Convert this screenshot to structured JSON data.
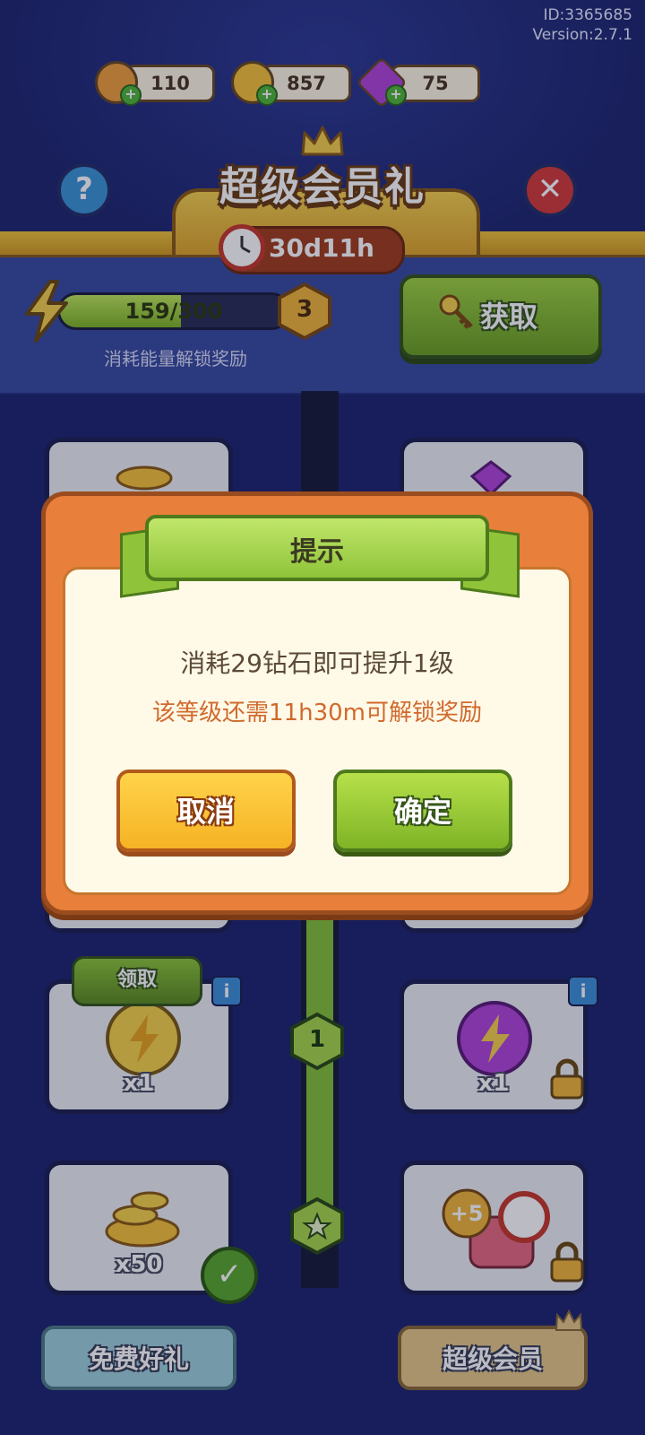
{
  "meta": {
    "id": "ID:3365685",
    "version": "Version:2.7.1"
  },
  "currencies": [
    {
      "name": "ticket",
      "value": "110",
      "icon": "ticket-icon",
      "color": "#f1a03c"
    },
    {
      "name": "coin",
      "value": "857",
      "icon": "coin-icon",
      "color": "#f7c23a"
    },
    {
      "name": "gem",
      "value": "75",
      "icon": "gem-icon",
      "color": "#b246d8"
    }
  ],
  "header": {
    "title": "超级会员礼",
    "timer": "30d11h"
  },
  "energy": {
    "progress_text": "159/300",
    "current": 159,
    "max": 300,
    "level": "3",
    "label": "消耗能量解锁奖励"
  },
  "get_button": {
    "label": "获取"
  },
  "rewards": {
    "claim_label": "领取",
    "free_energy_qty": "x1",
    "vip_energy_qty": "x1",
    "free_coin_qty": "x50",
    "vip_bundle_badge": "+5",
    "node_level": "1"
  },
  "tabs": {
    "free": "免费好礼",
    "vip": "超级会员"
  },
  "dialog": {
    "title": "提示",
    "message": "消耗29钻石即可提升1级",
    "sub_message": "该等级还需11h30m可解锁奖励",
    "cancel": "取消",
    "confirm": "确定"
  }
}
